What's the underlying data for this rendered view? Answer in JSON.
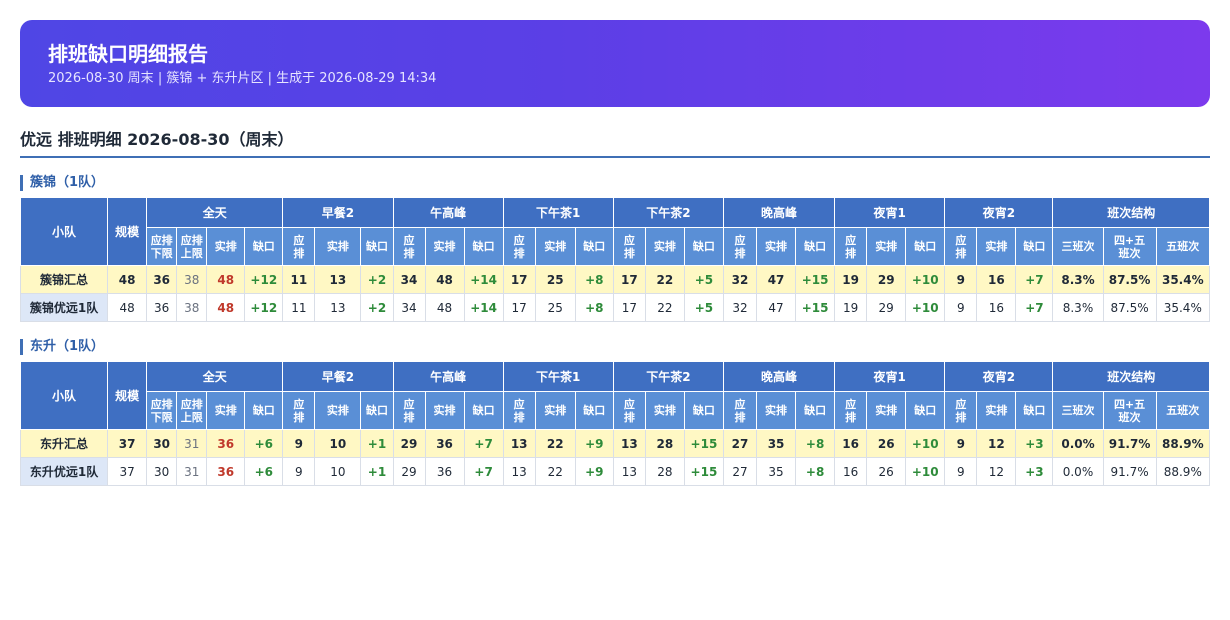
{
  "banner": {
    "title": "排班缺口明细报告",
    "subtitle": "2026-08-30 周末 | 簇锦 + 东升片区 | 生成于 2026-08-29 14:34"
  },
  "section_title": "优远 排班明细 2026-08-30（周末）",
  "headers": {
    "team": "小队",
    "scale": "规模",
    "groups": [
      "全天",
      "早餐2",
      "午高峰",
      "下午茶1",
      "下午茶2",
      "晚高峰",
      "夜宵1",
      "夜宵2",
      "班次结构"
    ],
    "allday_sub": [
      "应排\n下限",
      "应排\n上限",
      "实排",
      "缺口"
    ],
    "period_sub": [
      "应\n排",
      "实排",
      "缺口"
    ],
    "struct_sub": [
      "三班次",
      "四+五\n班次",
      "五班次"
    ]
  },
  "groups": [
    {
      "title": "簇锦（1队）",
      "rows": [
        {
          "type": "sum",
          "name": "簇锦汇总",
          "scale": "48",
          "allday": [
            "36",
            "38",
            "48",
            "+12"
          ],
          "periods": [
            [
              "11",
              "13",
              "+2"
            ],
            [
              "34",
              "48",
              "+14"
            ],
            [
              "17",
              "25",
              "+8"
            ],
            [
              "17",
              "22",
              "+5"
            ],
            [
              "32",
              "47",
              "+15"
            ],
            [
              "19",
              "29",
              "+10"
            ],
            [
              "9",
              "16",
              "+7"
            ]
          ],
          "struct": [
            "8.3%",
            "87.5%",
            "35.4%"
          ]
        },
        {
          "type": "team",
          "name": "簇锦优远1队",
          "scale": "48",
          "allday": [
            "36",
            "38",
            "48",
            "+12"
          ],
          "periods": [
            [
              "11",
              "13",
              "+2"
            ],
            [
              "34",
              "48",
              "+14"
            ],
            [
              "17",
              "25",
              "+8"
            ],
            [
              "17",
              "22",
              "+5"
            ],
            [
              "32",
              "47",
              "+15"
            ],
            [
              "19",
              "29",
              "+10"
            ],
            [
              "9",
              "16",
              "+7"
            ]
          ],
          "struct": [
            "8.3%",
            "87.5%",
            "35.4%"
          ]
        }
      ]
    },
    {
      "title": "东升（1队）",
      "rows": [
        {
          "type": "sum",
          "name": "东升汇总",
          "scale": "37",
          "allday": [
            "30",
            "31",
            "36",
            "+6"
          ],
          "periods": [
            [
              "9",
              "10",
              "+1"
            ],
            [
              "29",
              "36",
              "+7"
            ],
            [
              "13",
              "22",
              "+9"
            ],
            [
              "13",
              "28",
              "+15"
            ],
            [
              "27",
              "35",
              "+8"
            ],
            [
              "16",
              "26",
              "+10"
            ],
            [
              "9",
              "12",
              "+3"
            ]
          ],
          "struct": [
            "0.0%",
            "91.7%",
            "88.9%"
          ]
        },
        {
          "type": "team",
          "name": "东升优远1队",
          "scale": "37",
          "allday": [
            "30",
            "31",
            "36",
            "+6"
          ],
          "periods": [
            [
              "9",
              "10",
              "+1"
            ],
            [
              "29",
              "36",
              "+7"
            ],
            [
              "13",
              "22",
              "+9"
            ],
            [
              "13",
              "28",
              "+15"
            ],
            [
              "27",
              "35",
              "+8"
            ],
            [
              "16",
              "26",
              "+10"
            ],
            [
              "9",
              "12",
              "+3"
            ]
          ],
          "struct": [
            "0.0%",
            "91.7%",
            "88.9%"
          ]
        }
      ]
    }
  ]
}
